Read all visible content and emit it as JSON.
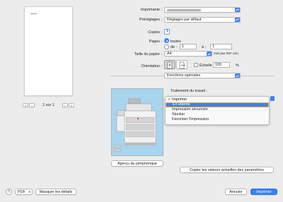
{
  "preview": {
    "page_indicator": "1 sur 1",
    "nav_first": "«",
    "nav_prev": "‹",
    "nav_next": "›",
    "nav_last": "»"
  },
  "form": {
    "printer_label": "Imprimante :",
    "printer_value": "",
    "presets_label": "Préréglages :",
    "presets_value": "Réglages par défaut",
    "copies_label": "Copies :",
    "copies_value": "1",
    "pages_label": "Pages :",
    "pages_all": "toutes",
    "pages_from": "de :",
    "pages_from_value": "1",
    "pages_to": "à :",
    "pages_to_value": "1",
    "paper_label": "Taille du papier :",
    "paper_value": "A4",
    "paper_dims": "210 par 297 mm",
    "orientation_label": "Orientation :",
    "scale_label": "Échelle :",
    "scale_value": "100",
    "scale_unit": "%",
    "section_value": "Fonctions spéciales"
  },
  "special": {
    "job_label": "Traitement du travail :",
    "menu_items": [
      "Imprimer",
      "En attente",
      "Impression sécurisée",
      "Stocker",
      "Favoriser l'impression"
    ],
    "checked_index": 0,
    "device_button": "Aperçu du périphérique",
    "copy_button": "Copier les valeurs actuelles des paramètres"
  },
  "footer": {
    "help": "?",
    "pdf": "PDF",
    "hide_details": "Masquer les détails",
    "cancel": "Annuler",
    "print": "Imprimer"
  },
  "colors": {
    "accent": "#3b82f6",
    "focus": "#f5a623"
  }
}
